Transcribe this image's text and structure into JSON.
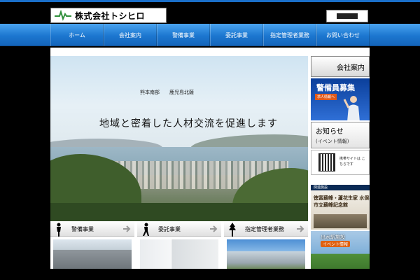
{
  "header": {
    "company_name": "株式会社トシヒロ",
    "logo_icon": "lightning-bolt-logo-icon"
  },
  "nav": {
    "items": [
      {
        "label": "ホーム"
      },
      {
        "label": "会社案内"
      },
      {
        "label": "警備事業"
      },
      {
        "label": "委託事業"
      },
      {
        "label": "指定管理者業務"
      },
      {
        "label": "お問い合わせ"
      }
    ]
  },
  "hero": {
    "region_left": "熊本南部",
    "region_right": "鹿児島北薩",
    "tagline": "地域と密着した人材交流を促進します"
  },
  "side": {
    "company_link": "会社案内",
    "recruit_title": "警備員募集",
    "recruit_sub": "求人情報へ",
    "news_title": "お知らせ",
    "news_sub": "(イベント情報)",
    "mobile_text": "携帯サイトは こちらです",
    "related_label": "関連施設",
    "sotoho_text": "徳富蘇峰・蘆花生家 水俣市立蘇峰記念館",
    "station_title": "出水駅施設",
    "station_sub": "イベント情報"
  },
  "cards": [
    {
      "label": "警備事業",
      "icon": "guard-figure-icon",
      "photo": "traffic-photo"
    },
    {
      "label": "委託事業",
      "icon": "walking-figure-icon",
      "photo": "office-photo"
    },
    {
      "label": "指定管理者業務",
      "icon": "tree-icon",
      "photo": "facility-photo"
    }
  ],
  "colors": {
    "nav_blue": "#1c77d0",
    "recruit_blue": "#0b3f9a",
    "accent_orange": "#e15a1a"
  }
}
